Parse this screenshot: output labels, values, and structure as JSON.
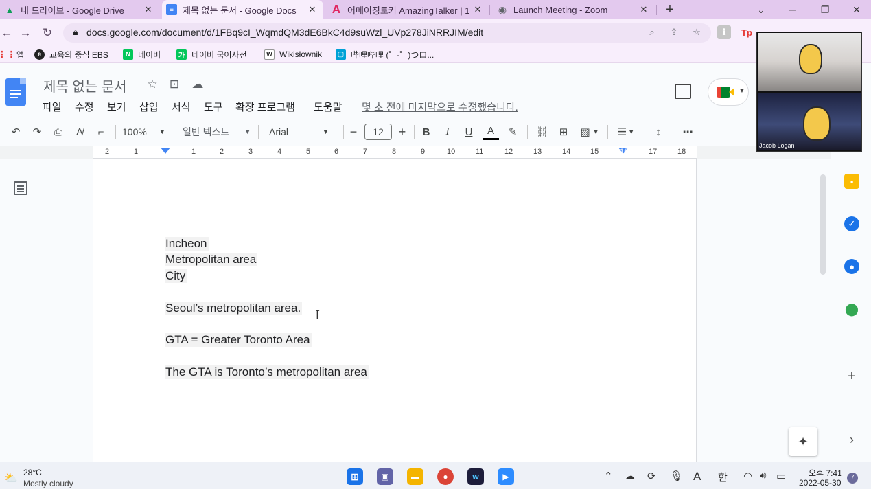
{
  "browser": {
    "tabs": [
      {
        "title": "내 드라이브 - Google Drive",
        "icon": "google-drive-icon",
        "active": false
      },
      {
        "title": "제목 없는 문서 - Google Docs",
        "icon": "google-docs-icon",
        "active": true
      },
      {
        "title": "어메이징토커 AmazingTalker | 1",
        "icon": "amazingtalker-icon",
        "active": false
      },
      {
        "title": "Launch Meeting - Zoom",
        "icon": "globe-icon",
        "active": false
      }
    ],
    "url": "docs.google.com/document/d/1FBq9cI_WqmdQM3dE6BkC4d9suWzl_UVp278JiNRRJIM/edit"
  },
  "bookmarks": [
    {
      "label": "앱",
      "icon": "apps-grid-icon"
    },
    {
      "label": "교육의 중심 EBS",
      "icon": "ebs-icon"
    },
    {
      "label": "네이버",
      "icon": "naver-icon"
    },
    {
      "label": "네이버 국어사전",
      "icon": "naver-dictionary-icon"
    },
    {
      "label": "Wikisłownik",
      "icon": "wiktionary-icon"
    },
    {
      "label": "哔哩哔哩 (゜-゜)つロ...",
      "icon": "bilibili-icon"
    }
  ],
  "docs": {
    "title": "제목 없는 문서",
    "menu": [
      "파일",
      "수정",
      "보기",
      "삽입",
      "서식",
      "도구",
      "확장 프로그램",
      "도움말"
    ],
    "last_edit": "몇 초 전에 마지막으로 수정했습니다.",
    "toolbar": {
      "zoom": "100%",
      "style": "일반 텍스트",
      "font": "Arial",
      "font_size": "12"
    },
    "ruler_numbers": [
      "2",
      "1",
      "1",
      "2",
      "3",
      "4",
      "5",
      "6",
      "7",
      "8",
      "9",
      "10",
      "11",
      "12",
      "13",
      "14",
      "15",
      "16",
      "17",
      "18"
    ],
    "body_lines": [
      "Incheon",
      "Metropolitan area",
      "City",
      "Seoul’s metropolitan area.",
      "GTA = Greater Toronto Area",
      "The GTA is Toronto’s metropolitan area"
    ]
  },
  "zoom_overlay": {
    "participant_name": "Jacob Logan"
  },
  "taskbar": {
    "weather_temp": "28°C",
    "weather_desc": "Mostly cloudy",
    "time": "오후 7:41",
    "date": "2022-05-30",
    "notification_count": "7",
    "ime": "한",
    "lang": "A"
  },
  "colors": {
    "tab_strip": "#e3c9ee",
    "docs_blue": "#4285f4",
    "keep_yellow": "#fbbc04",
    "tasks_blue": "#1a73e8"
  }
}
